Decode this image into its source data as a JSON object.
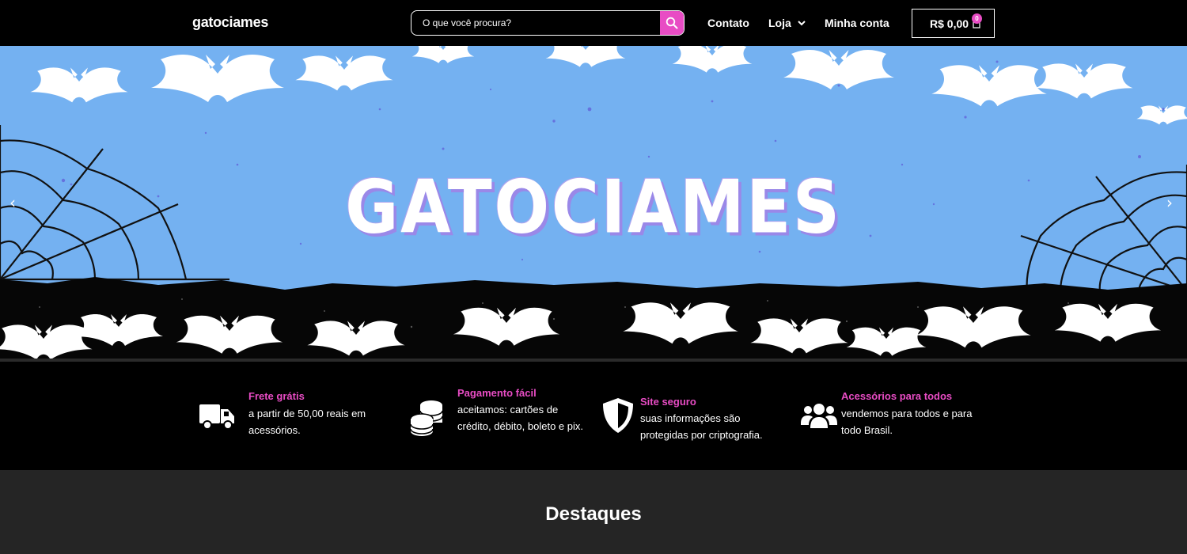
{
  "header": {
    "logo": "gatociames",
    "search": {
      "placeholder": "O que você procura?"
    },
    "nav": {
      "contato": "Contato",
      "loja": "Loja",
      "conta": "Minha conta"
    },
    "cart": {
      "total": "R$ 0,00",
      "count": "0"
    }
  },
  "hero": {
    "title": "GATOCIAMES"
  },
  "features": [
    {
      "icon": "truck-icon",
      "title": "Frete grátis",
      "text": "a partir de 50,00 reais em acessórios."
    },
    {
      "icon": "coins-icon",
      "title": "Pagamento fácil",
      "text": "aceitamos: cartões de crédito, débito, boleto e pix."
    },
    {
      "icon": "shield-icon",
      "title": "Site seguro",
      "text": "suas informações são protegidas por criptografia."
    },
    {
      "icon": "users-icon",
      "title": "Acessórios para todos",
      "text": "vendemos para todos e para todo Brasil."
    }
  ],
  "destaques": {
    "title": "Destaques"
  },
  "colors": {
    "accent": "#e84cc4",
    "hero_bg": "#74b1f1",
    "dark_section": "#252525"
  }
}
